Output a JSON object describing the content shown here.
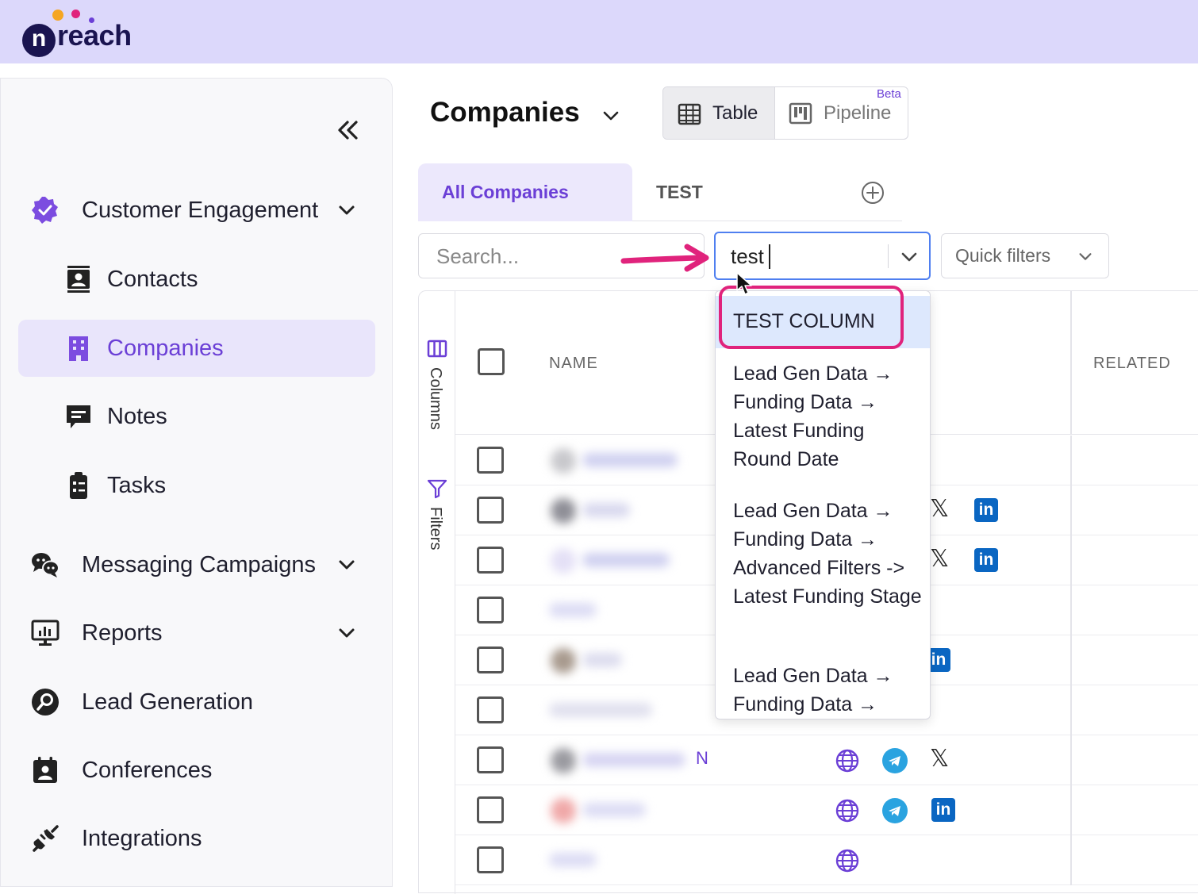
{
  "brand": {
    "name": "reach",
    "logo_letter": "n",
    "color": "#1a1450"
  },
  "sidebar": {
    "items": [
      {
        "label": "Customer Engagement",
        "icon": "verified-badge-icon",
        "expandable": true
      },
      {
        "label": "Contacts",
        "icon": "contact-card-icon"
      },
      {
        "label": "Companies",
        "icon": "building-icon",
        "active": true
      },
      {
        "label": "Notes",
        "icon": "note-icon"
      },
      {
        "label": "Tasks",
        "icon": "clipboard-icon"
      },
      {
        "label": "Messaging Campaigns",
        "icon": "chat-bubbles-icon",
        "expandable": true
      },
      {
        "label": "Reports",
        "icon": "monitor-chart-icon",
        "expandable": true
      },
      {
        "label": "Lead Generation",
        "icon": "magnifier-icon"
      },
      {
        "label": "Conferences",
        "icon": "calendar-person-icon"
      },
      {
        "label": "Integrations",
        "icon": "plug-icon"
      }
    ]
  },
  "header": {
    "title": "Companies",
    "views": {
      "table": "Table",
      "pipeline": "Pipeline",
      "pipeline_badge": "Beta"
    }
  },
  "tabs": {
    "all": "All Companies",
    "test": "TEST"
  },
  "filters": {
    "search_placeholder": "Search...",
    "column_search_value": "test",
    "quick_filters": "Quick filters"
  },
  "side_tools": {
    "columns": "Columns",
    "filters": "Filters"
  },
  "table": {
    "columns": {
      "name": "NAME",
      "related": "RELATED"
    },
    "row_fragment": "N"
  },
  "dropdown": {
    "options": [
      "TEST COLUMN",
      "Lead Gen Data → Funding Data → Latest Funding Round Date",
      "Lead Gen Data → Funding Data → Advanced Filters -> Latest Funding Stage",
      "Lead Gen Data → Funding Data →"
    ]
  },
  "colors": {
    "accent": "#6b3fd6",
    "highlight_ring": "#e0237c",
    "annotation_arrow": "#e0237c",
    "linkedin": "#0a66c2",
    "telegram": "#2aa3e0"
  }
}
